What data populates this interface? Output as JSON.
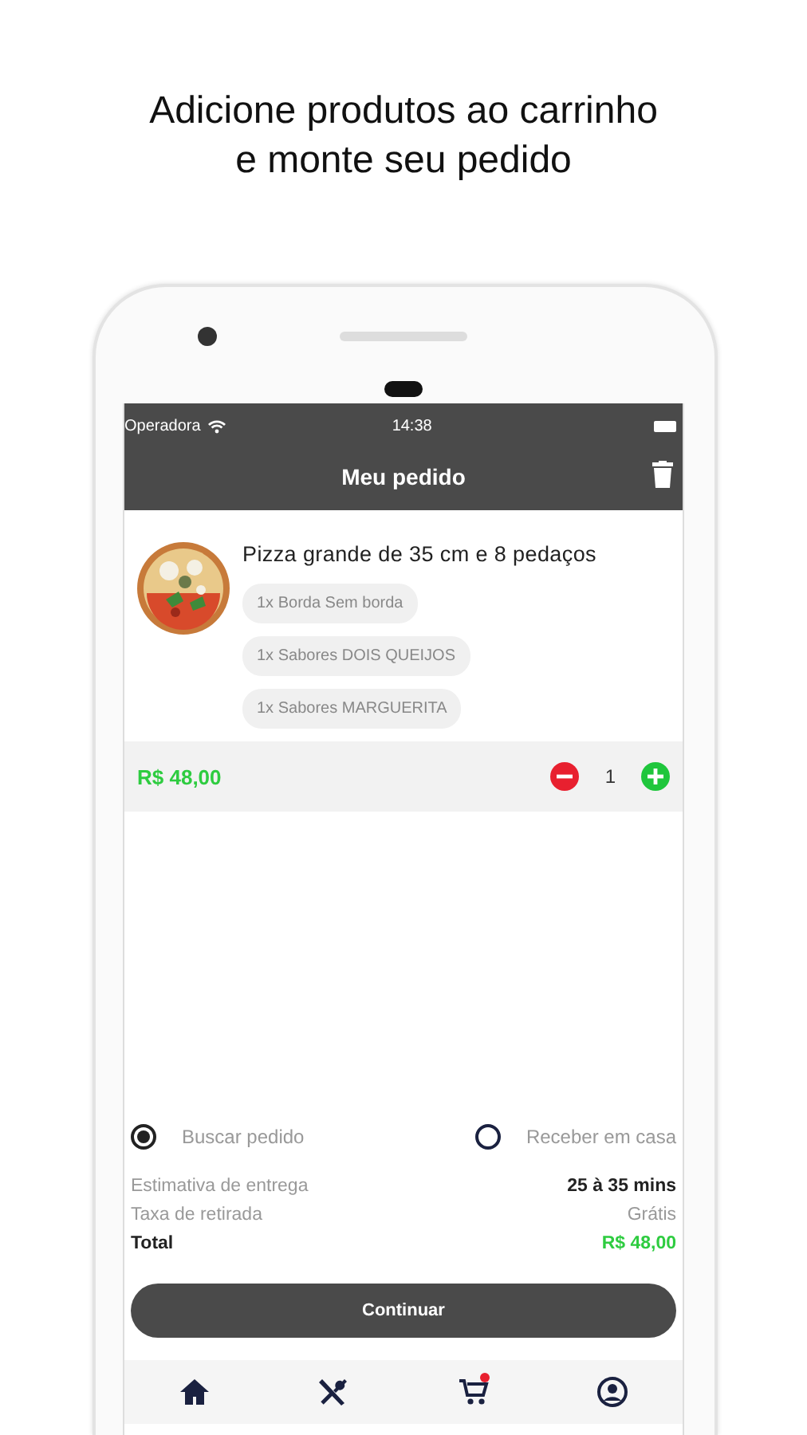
{
  "caption": [
    "Adicione produtos ao carrinho",
    "e monte seu pedido"
  ],
  "status_bar": {
    "carrier": "Operadora",
    "time": "14:38"
  },
  "header": {
    "title": "Meu pedido"
  },
  "cart_items": [
    {
      "name": "Pizza grande de 35 cm  e 8 pedaços",
      "options": [
        "1x Borda Sem borda",
        "1x Sabores DOIS QUEIJOS",
        "1x Sabores MARGUERITA"
      ],
      "price": "R$ 48,00",
      "quantity": "1"
    }
  ],
  "delivery_options": [
    {
      "label": "Buscar pedido",
      "selected": true
    },
    {
      "label": "Receber em casa",
      "selected": false
    }
  ],
  "summary": [
    {
      "kind": "estimate",
      "label": "Estimativa de entrega",
      "value": "25 à 35 mins"
    },
    {
      "kind": "fee",
      "label": "Taxa de retirada",
      "value": "Grátis"
    },
    {
      "kind": "total",
      "label": "Total",
      "value": "R$ 48,00"
    }
  ],
  "continue_button": "Continuar",
  "bottom_tabs": [
    {
      "kind": "home",
      "badge": false
    },
    {
      "kind": "utensils",
      "badge": false
    },
    {
      "kind": "cart",
      "badge": true
    },
    {
      "kind": "profile",
      "badge": false
    }
  ]
}
